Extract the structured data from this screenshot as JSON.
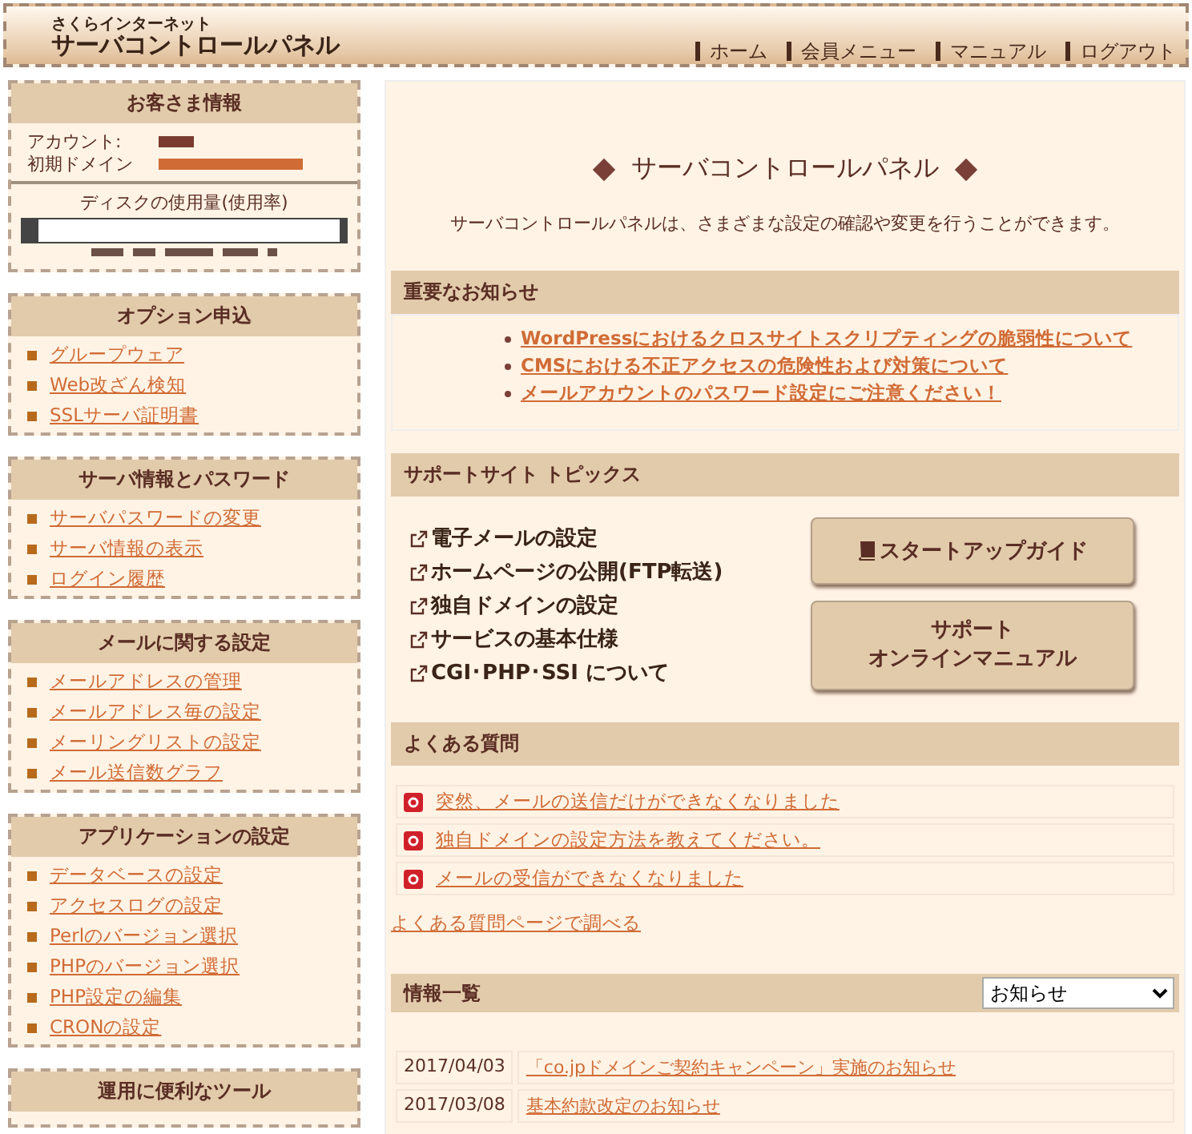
{
  "header": {
    "brand_small": "さくらインターネット",
    "brand": "サーバコントロールパネル",
    "nav": [
      "ホーム",
      "会員メニュー",
      "マニュアル",
      "ログアウト"
    ]
  },
  "sidebar": {
    "customer": {
      "title": "お客さま情報",
      "account_label": "アカウント:",
      "domain_label": "初期ドメイン",
      "disk_label": "ディスクの使用量(使用率)",
      "disk": {
        "level": 0.03
      }
    },
    "sections": [
      {
        "title": "オプション申込",
        "items": [
          "グループウェア",
          "Web改ざん検知",
          "SSLサーバ証明書"
        ]
      },
      {
        "title": "サーバ情報とパスワード",
        "items": [
          "サーバパスワードの変更",
          "サーバ情報の表示",
          "ログイン履歴"
        ]
      },
      {
        "title": "メールに関する設定",
        "items": [
          "メールアドレスの管理",
          "メールアドレス毎の設定",
          "メーリングリストの設定",
          "メール送信数グラフ"
        ]
      },
      {
        "title": "アプリケーションの設定",
        "items": [
          "データベースの設定",
          "アクセスログの設定",
          "Perlのバージョン選択",
          "PHPのバージョン選択",
          "PHP設定の編集",
          "CRONの設定"
        ]
      },
      {
        "title": "運用に便利なツール"
      }
    ]
  },
  "main": {
    "title": "サーバコントロールパネル",
    "description": "サーバコントロールパネルは、さまざまな設定の確認や変更を行うことができます。",
    "notices": {
      "title": "重要なお知らせ",
      "items": [
        "WordPressにおけるクロスサイトスクリプティングの脆弱性について",
        "CMSにおける不正アクセスの危険性および対策について",
        "メールアカウントのパスワード設定にご注意ください！"
      ]
    },
    "topics": {
      "title": "サポートサイト トピックス",
      "links": [
        "電子メールの設定",
        "ホームページの公開(FTP転送)",
        "独自ドメインの設定",
        "サービスの基本仕様",
        "CGI･PHP･SSI について"
      ],
      "buttons": [
        {
          "kind": "guide",
          "lines": [
            "スタートアップガイド"
          ]
        },
        {
          "kind": "manual",
          "lines": [
            "サポート",
            "オンラインマニュアル"
          ]
        }
      ]
    },
    "faq": {
      "title": "よくある質問",
      "questions": [
        "突然、メールの送信だけができなくなりました",
        "独自ドメインの設定方法を教えてください。",
        "メールの受信ができなくなりました"
      ],
      "more": "よくある質問ページで調べる"
    },
    "info": {
      "title": "情報一覧",
      "filter": "お知らせ",
      "rows": [
        {
          "date": "2017/04/03",
          "text": "「co.jpドメインご契約キャンペーン」実施のお知らせ"
        },
        {
          "date": "2017/03/08",
          "text": "基本約款改定のお知らせ"
        }
      ]
    }
  }
}
